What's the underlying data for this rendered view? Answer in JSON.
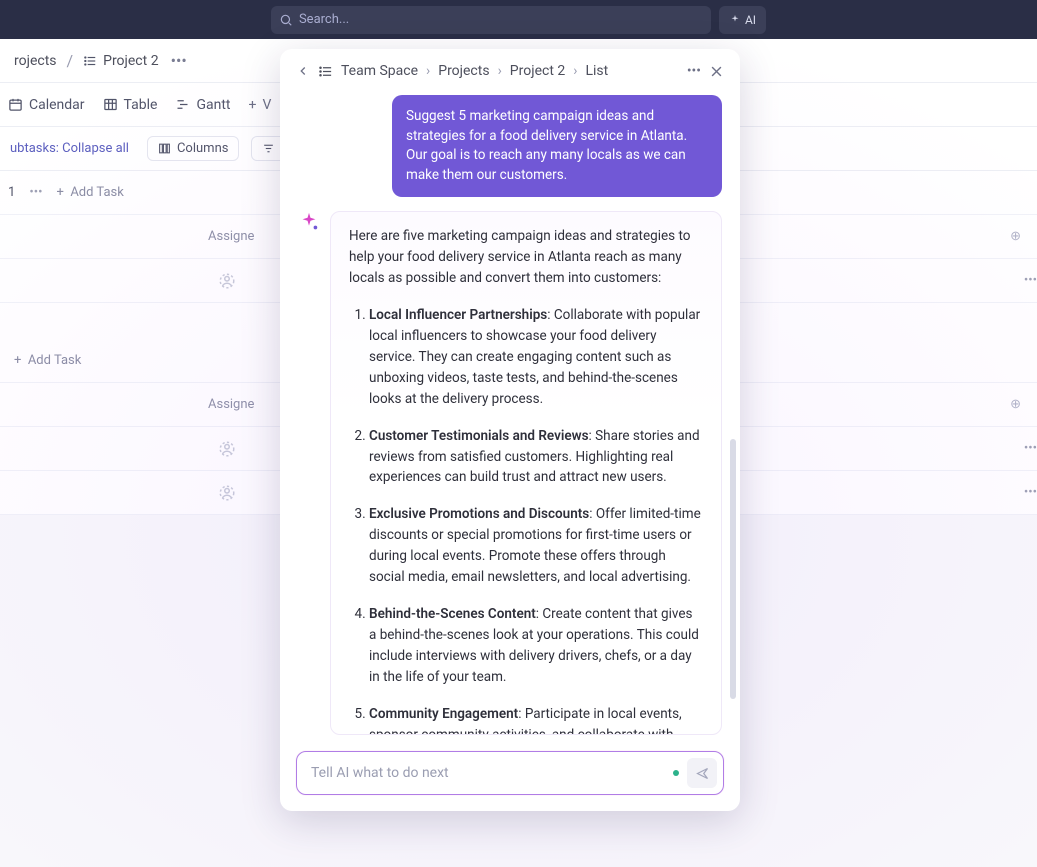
{
  "topbar": {
    "search_placeholder": "Search...",
    "ai_label": "AI"
  },
  "breadcrumb": {
    "parent": "rojects",
    "current": "Project 2"
  },
  "views": {
    "calendar": "Calendar",
    "table": "Table",
    "gantt": "Gantt",
    "add": "V"
  },
  "filters": {
    "subtasks": "ubtasks: Collapse all",
    "columns": "Columns",
    "filters": "Filters"
  },
  "table": {
    "group1_count": "1",
    "add_task": "Add Task",
    "assignee_header": "Assigne"
  },
  "modal": {
    "crumbs": [
      "Team Space",
      "Projects",
      "Project 2",
      "List"
    ],
    "user_prompt": "Suggest 5 marketing campaign ideas and strategies for a food delivery service in Atlanta. Our goal is to reach any many locals as we can make them our customers.",
    "intro": "Here are five marketing campaign ideas and strategies to help your food delivery service in Atlanta reach as many locals as possible and convert them into customers:",
    "items": [
      {
        "title": "Local Influencer Partnerships",
        "body": ": Collaborate with popular local influencers to showcase your food delivery service. They can create engaging content such as unboxing videos, taste tests, and behind-the-scenes looks at the delivery process."
      },
      {
        "title": "Customer Testimonials and Reviews",
        "body": ": Share stories and reviews from satisfied customers. Highlighting real experiences can build trust and attract new users."
      },
      {
        "title": "Exclusive Promotions and Discounts",
        "body": ": Offer limited-time discounts or special promotions for first-time users or during local events. Promote these offers through social media, email newsletters, and local advertising."
      },
      {
        "title": "Behind-the-Scenes Content",
        "body": ": Create content that gives a behind-the-scenes look at your operations. This could include interviews with delivery drivers, chefs, or a day in the life of your team."
      },
      {
        "title": "Community Engagement",
        "body": ": Participate in local events, sponsor community activities, and collaborate with local businesses. Engaging with the community can increase brand visibility and foster a loyal customer base."
      }
    ],
    "input_placeholder": "Tell AI what to do next"
  }
}
